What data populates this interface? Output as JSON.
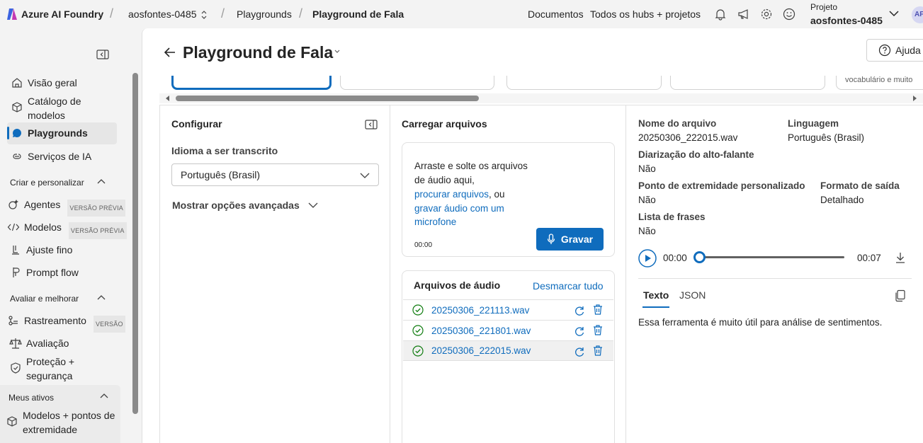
{
  "topbar": {
    "brand": "Azure AI Foundry",
    "workspace": "aosfontes-0485",
    "crumb_playgrounds": "Playgrounds",
    "crumb_current": "Playground de Fala",
    "docs": "Documentos",
    "all_hubs": "Todos os hubs + projetos",
    "project_label": "Projeto",
    "project_name": "aosfontes-0485",
    "avatar_initials": "AF"
  },
  "nav": {
    "overview": "Visão geral",
    "catalog_line1": "Catálogo de",
    "catalog_line2": "modelos",
    "playgrounds": "Playgrounds",
    "ai_services": "Serviços de IA",
    "section_create": "Criar e personalizar",
    "agents": "Agentes",
    "agents_badge": "VERSÃO PRÉVIA",
    "models": "Modelos",
    "models_badge": "VERSÃO PRÉVIA",
    "finetune": "Ajuste fino",
    "promptflow": "Prompt flow",
    "section_eval": "Avaliar e melhorar",
    "tracing": "Rastreamento",
    "tracing_badge": "VERSÃO",
    "evaluation": "Avaliação",
    "safety_line1": "Proteção +",
    "safety_line2": "segurança",
    "section_assets": "Meus ativos",
    "endpoints_line1": "Modelos + pontos de",
    "endpoints_line2": "extremidade"
  },
  "page": {
    "title": "Playground de Fala",
    "help": "Ajuda",
    "tile_partial_text": "vocabulário e muito"
  },
  "configure": {
    "title": "Configurar",
    "language_label": "Idioma a ser transcrito",
    "language_value": "Português (Brasil)",
    "advanced": "Mostrar opções avançadas"
  },
  "upload": {
    "title": "Carregar arquivos",
    "drop_line1": "Arraste e solte os arquivos",
    "drop_line2": "de áudio aqui,",
    "browse_link": "procurar arquivos",
    "or": ", ou",
    "record_link_line1": "gravar áudio com um",
    "record_link_line2": "microfone",
    "timer": "00:00",
    "record_button": "Gravar",
    "files_title": "Arquivos de áudio",
    "deselect_all": "Desmarcar tudo",
    "files": [
      {
        "name": "20250306_221113.wav"
      },
      {
        "name": "20250306_221801.wav"
      },
      {
        "name": "20250306_222015.wav"
      }
    ]
  },
  "details": {
    "filename_label": "Nome do arquivo",
    "filename_value": "20250306_222015.wav",
    "language_label": "Linguagem",
    "language_value": "Português (Brasil)",
    "diarization_label": "Diarização do alto-falante",
    "diarization_value": "Não",
    "endpoint_label": "Ponto de extremidade personalizado",
    "endpoint_value": "Não",
    "format_label": "Formato de saída",
    "format_value": "Detalhado",
    "phrases_label": "Lista de frases",
    "phrases_value": "Não",
    "time_current": "00:00",
    "time_total": "00:07",
    "playback_progress": 0,
    "tab_text": "Texto",
    "tab_json": "JSON",
    "transcript": "Essa ferramenta é muito útil para análise de sentimentos."
  },
  "colors": {
    "accent": "#0f6cbd",
    "success": "#107c10",
    "brand_purple": "#5b5fc7"
  }
}
